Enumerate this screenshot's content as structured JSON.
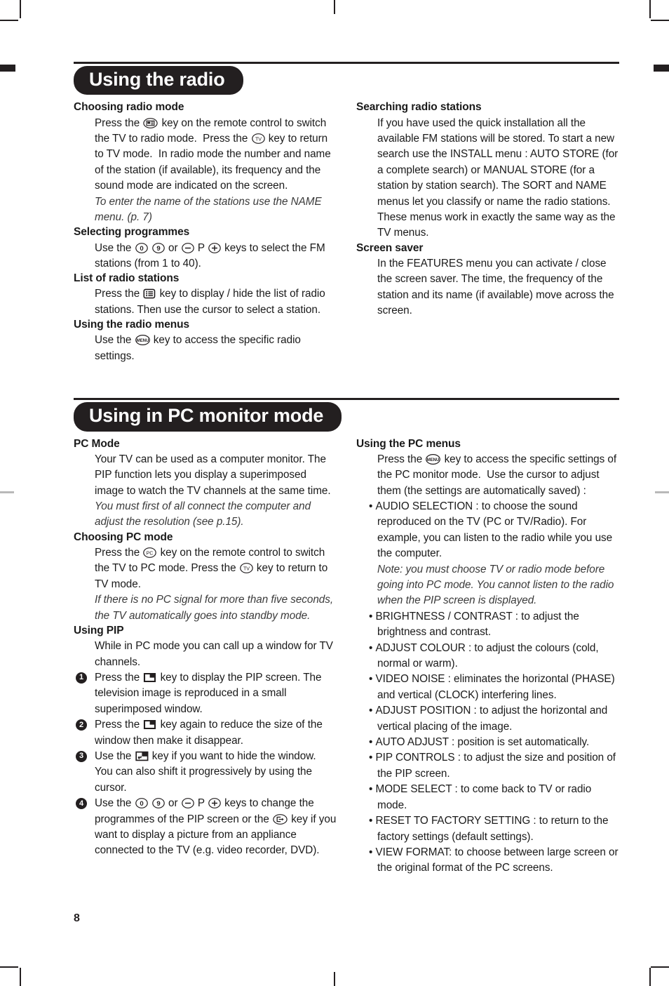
{
  "page": {
    "number": "8"
  },
  "sections": [
    {
      "id": "using-the-radio",
      "title": "Using the radio",
      "left": [
        {
          "type": "head",
          "text": "Choosing radio mode"
        },
        {
          "type": "body",
          "icons": [
            "radio-key-icon",
            "tv-key-icon"
          ],
          "text": "Press the  key on the remote control to switch the TV to radio mode.  Press the  key to return to TV mode.  In radio mode the number and name of the station (if available), its frequency and the sound mode are indicated on the screen."
        },
        {
          "type": "body-italic",
          "text": "To enter the name of the stations use the NAME menu. (p. 7)"
        },
        {
          "type": "head",
          "text": "Selecting programmes"
        },
        {
          "type": "body",
          "icons": [
            "digit-0-key-icon",
            "digit-9-key-icon",
            "minus-key-icon",
            "plus-key-icon"
          ],
          "text": "Use the  or P keys to select the FM stations (from 1 to 40)."
        },
        {
          "type": "head",
          "text": "List of radio stations"
        },
        {
          "type": "body",
          "icons": [
            "list-key-icon"
          ],
          "text": "Press the  key to display / hide the list of radio stations. Then use the cursor to select a station."
        },
        {
          "type": "head",
          "text": "Using the radio menus"
        },
        {
          "type": "body",
          "icons": [
            "menu-key-icon"
          ],
          "text": "Use the  key to access the specific radio settings."
        }
      ],
      "right": [
        {
          "type": "head",
          "text": "Searching radio stations"
        },
        {
          "type": "body",
          "text": "If you have used the quick installation all the available FM stations will be stored. To start a new search use the INSTALL menu : AUTO STORE (for a complete search) or MANUAL STORE (for a station by station search). The SORT and NAME menus let you classify or name the radio stations. These menus work in exactly the same way as the TV menus."
        },
        {
          "type": "head",
          "text": "Screen saver"
        },
        {
          "type": "body",
          "text": "In the FEATURES menu you can activate / close the screen saver. The time, the frequency of the station and its name (if available) move across the screen."
        }
      ]
    },
    {
      "id": "using-in-pc-monitor-mode",
      "title": "Using in PC monitor mode",
      "left": [
        {
          "type": "head",
          "text": "PC Mode"
        },
        {
          "type": "body",
          "text": "Your TV can be used as a computer monitor. The PIP function lets you display a superimposed image to watch the TV channels at the same time."
        },
        {
          "type": "body-italic",
          "text": "You must first of all connect the computer and adjust the resolution (see p.15)."
        },
        {
          "type": "head",
          "text": "Choosing PC mode"
        },
        {
          "type": "body",
          "icons": [
            "pc-key-icon",
            "tv-key-icon"
          ],
          "text": "Press the  key on the remote control to switch the TV to PC mode. Press the  key to return to TV mode."
        },
        {
          "type": "body-italic",
          "text": "If there is no PC signal for more than five seconds, the TV automatically goes into standby mode."
        },
        {
          "type": "head",
          "text": "Using PIP"
        },
        {
          "type": "body",
          "text": "While in PC mode you can call up a window for TV channels."
        },
        {
          "type": "numbered",
          "num": "1",
          "icons": [
            "pip-key-icon"
          ],
          "text": "Press the  key to display the PIP screen. The television image is reproduced in a small superimposed window."
        },
        {
          "type": "numbered",
          "num": "2",
          "icons": [
            "pip-key-icon"
          ],
          "text": "Press the  key again to reduce the size of the window then make it disappear."
        },
        {
          "type": "numbered",
          "num": "3",
          "icons": [
            "pip-shift-key-icon"
          ],
          "text": "Use the  key if you want to hide the window. You can also shift it progressively by using the cursor."
        },
        {
          "type": "numbered",
          "num": "4",
          "icons": [
            "digit-0-key-icon",
            "digit-9-key-icon",
            "minus-key-icon",
            "plus-key-icon",
            "source-key-icon"
          ],
          "text": "Use the  or P keys to change the programmes of the PIP screen or the  key if you want to display a picture from an appliance connected to the TV (e.g. video recorder, DVD)."
        }
      ],
      "right": [
        {
          "type": "head",
          "text": "Using the PC menus"
        },
        {
          "type": "body",
          "icons": [
            "menu-key-icon"
          ],
          "text": "Press the  key to access the specific settings of the PC monitor mode.  Use the cursor to adjust them (the settings are automatically saved) :"
        },
        {
          "type": "bullet",
          "text": "AUDIO SELECTION : to choose the sound reproduced on the TV (PC or TV/Radio). For example, you can listen to the radio while you use the computer."
        },
        {
          "type": "bullet-italic",
          "text": "Note: you must choose TV or radio mode before going into PC mode. You cannot listen to the radio when the PIP screen is displayed."
        },
        {
          "type": "bullet",
          "text": "BRIGHTNESS / CONTRAST : to adjust the brightness and contrast."
        },
        {
          "type": "bullet",
          "text": "ADJUST COLOUR : to adjust the colours (cold, normal or warm)."
        },
        {
          "type": "bullet",
          "text": "VIDEO NOISE : eliminates the horizontal (PHASE) and vertical (CLOCK) interfering lines."
        },
        {
          "type": "bullet",
          "text": "ADJUST POSITION : to adjust the horizontal and vertical placing of the image."
        },
        {
          "type": "bullet",
          "text": "AUTO ADJUST : position is set automatically."
        },
        {
          "type": "bullet",
          "text": "PIP CONTROLS : to adjust the size and position of the PIP screen."
        },
        {
          "type": "bullet",
          "text": "MODE SELECT : to come back to TV or radio mode."
        },
        {
          "type": "bullet",
          "text": "RESET TO FACTORY SETTING : to return to the factory settings (default settings)."
        },
        {
          "type": "bullet",
          "text": "VIEW FORMAT: to choose between large screen or the original format of the PC screens."
        }
      ]
    }
  ],
  "colors": {
    "ink": "#231f20",
    "banner_bg": "#231f20",
    "banner_text": "#ffffff"
  }
}
